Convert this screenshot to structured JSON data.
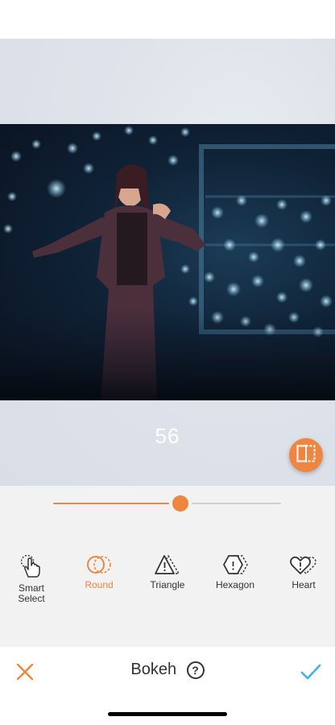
{
  "canvas": {
    "value": "56",
    "compare_icon": "compare-split-icon"
  },
  "slider": {
    "value": 56,
    "min": 0,
    "max": 100
  },
  "tools": [
    {
      "label": "Smart\nSelect",
      "icon": "smart-select-hand-icon",
      "active": false
    },
    {
      "label": "Round",
      "icon": "round-circles-icon",
      "active": true
    },
    {
      "label": "Triangle",
      "icon": "triangle-icon",
      "active": false
    },
    {
      "label": "Hexagon",
      "icon": "hexagon-icon",
      "active": false
    },
    {
      "label": "Heart",
      "icon": "heart-icon",
      "active": false
    }
  ],
  "bottom_bar": {
    "title": "Bokeh",
    "help": "?",
    "cancel_icon": "close-x-icon",
    "confirm_icon": "checkmark-icon"
  },
  "colors": {
    "accent": "#ee8540",
    "confirm": "#3cb4e5",
    "text": "#333333"
  }
}
